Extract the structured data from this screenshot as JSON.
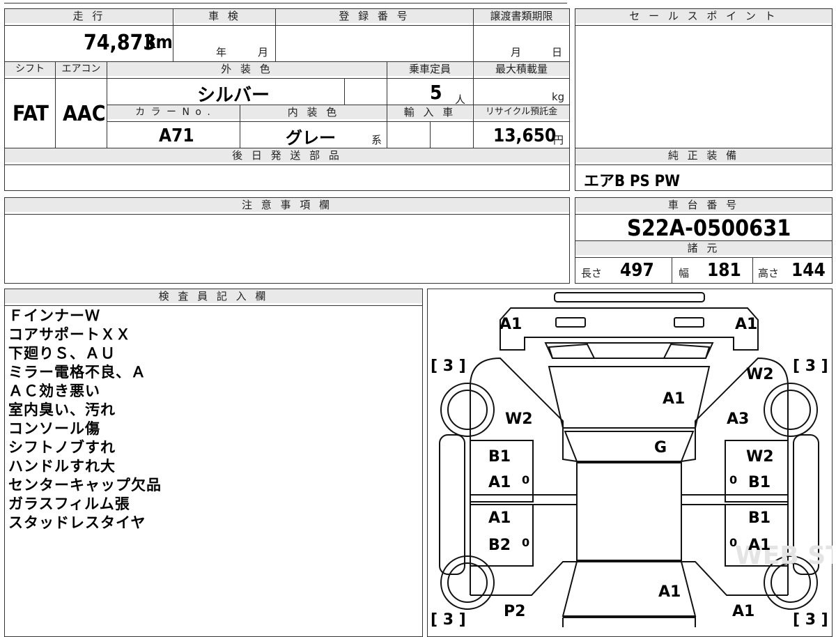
{
  "header": {
    "mileage_label": "走 行",
    "inspection_label": "車 検",
    "reg_number_label": "登 録 番 号",
    "transfer_deadline_label": "譲渡書類期限",
    "sales_point_label": "セ ー ル ス ポ イ ン ト"
  },
  "mileage": {
    "value": "74,873",
    "unit": "km"
  },
  "inspection": {
    "year_unit": "年",
    "month_unit": "月"
  },
  "transfer_deadline": {
    "month_unit": "月",
    "day_unit": "日"
  },
  "labels": {
    "shift": "シフト",
    "aircon": "エアコン",
    "exterior_color": "外 装 色",
    "capacity": "乗車定員",
    "max_load": "最大積載量",
    "color_no": "カ ラ ー N o .",
    "interior_color": "内 装 色",
    "import": "輸 入 車",
    "recycle_fee": "リサイクル預託金",
    "later_parts": "後 日 発 送 部 品",
    "factory_equip": "純 正 装 備",
    "notes": "注 意 事 項 欄",
    "chassis_no": "車 台 番 号",
    "specs": "諸 元",
    "inspector": "検 査 員 記 入 欄"
  },
  "vehicle": {
    "shift": "FAT",
    "aircon": "AAC",
    "exterior_color": "シルバー",
    "capacity": "5",
    "capacity_unit": "人",
    "max_load_unit": "kg",
    "color_no": "A71",
    "interior_color": "グレー",
    "interior_suffix": "系",
    "recycle_fee": "13,650",
    "recycle_unit": "円",
    "factory_equip": "エアB PS PW",
    "chassis_no": "S22A-0500631"
  },
  "specs": {
    "length_label": "長さ",
    "length": "497",
    "width_label": "幅",
    "width": "181",
    "height_label": "高さ",
    "height": "144"
  },
  "inspector_notes": [
    "ＦインナーＷ",
    "コアサポートＸＸ",
    "下廻りＳ、ＡＵ",
    "ミラー電格不良、Ａ",
    "ＡＣ効き悪い",
    "室内臭い、汚れ",
    "コンソール傷",
    "シフトノブすれ",
    "ハンドルすれ大",
    "センターキャップ欠品",
    "ガラスフィルム張",
    "スタッドレスタイヤ"
  ],
  "damage_map": {
    "front_left": "A1",
    "front_right": "A1",
    "tire_fl": "[ 3 ]",
    "tire_fr": "[ 3 ]",
    "tire_rl": "[ 3 ]",
    "tire_rr": "[ 3 ]",
    "fender_fl": "W2",
    "fender_fr1": "W2",
    "fender_fr2": "A3",
    "hood": "A1",
    "windshield": "G",
    "door_fl1": "B1",
    "door_fl2": "A1",
    "door_fr1": "W2",
    "door_fr2": "B1",
    "door_rl1": "A1",
    "door_rl2": "B2",
    "door_rr1": "B1",
    "door_rr2": "A1",
    "roof": "A1",
    "quarter_rl": "P2",
    "quarter_rr": "A1",
    "mark": "0"
  },
  "watermark": "WEB STUDIO PRO"
}
